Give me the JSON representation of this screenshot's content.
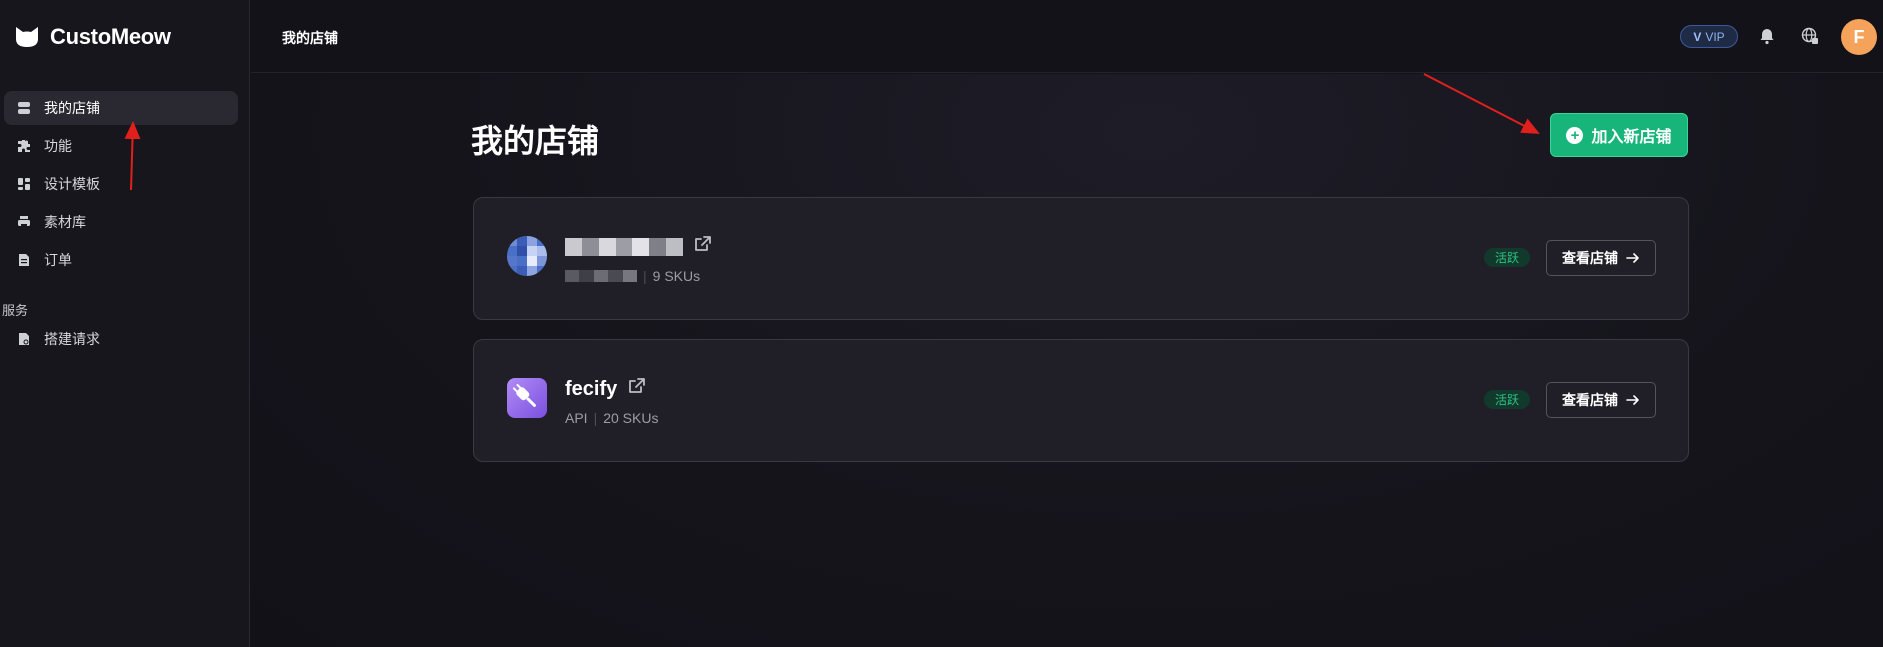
{
  "app": {
    "brand_name": "CustoMeow"
  },
  "sidebar": {
    "items": [
      {
        "label": "我的店铺",
        "icon": "store-icon",
        "active": true
      },
      {
        "label": "功能",
        "icon": "puzzle-icon"
      },
      {
        "label": "设计模板",
        "icon": "grid-icon"
      },
      {
        "label": "素材库",
        "icon": "printer-icon"
      },
      {
        "label": "订单",
        "icon": "document-icon"
      }
    ],
    "section_label": "服务",
    "service_items": [
      {
        "label": "搭建请求",
        "icon": "request-icon"
      }
    ]
  },
  "topbar": {
    "title": "我的店铺",
    "vip_label": "VIP",
    "avatar_initial": "F"
  },
  "main": {
    "page_title": "我的店铺",
    "add_store_label": "加入新店铺",
    "stores": [
      {
        "name": "",
        "platform": "",
        "skus": "9 SKUs",
        "status": "活跃",
        "view_label": "查看店铺",
        "name_obscured": true
      },
      {
        "name": "fecify",
        "platform": "API",
        "skus": "20 SKUs",
        "status": "活跃",
        "view_label": "查看店铺",
        "name_obscured": false
      }
    ]
  },
  "colors": {
    "accent_green": "#18b57a",
    "status_green": "#2fc186",
    "avatar_orange": "#f5a35a",
    "vip_blue": "#8fb1f2",
    "annotation_red": "#e0201c"
  }
}
